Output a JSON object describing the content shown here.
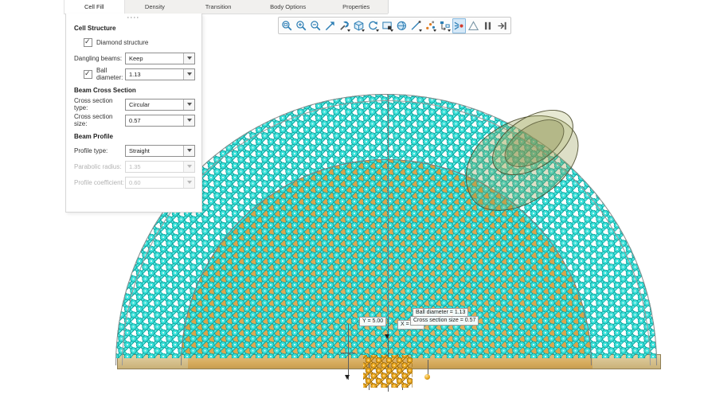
{
  "tabs": [
    {
      "label": "Cell Fill",
      "active": true
    },
    {
      "label": "Density",
      "active": false
    },
    {
      "label": "Transition",
      "active": false
    },
    {
      "label": "Body Options",
      "active": false
    },
    {
      "label": "Properties",
      "active": false
    }
  ],
  "panel": {
    "sections": [
      {
        "title": "Cell Structure",
        "fields": [
          {
            "type": "checkbox",
            "label": "Diamond structure",
            "checked": true
          },
          {
            "type": "dropdown",
            "label": "Dangling beams:",
            "value": "Keep"
          },
          {
            "type": "checkbox-dropdown",
            "label": "Ball diameter:",
            "checked": true,
            "value": "1.13"
          }
        ]
      },
      {
        "title": "Beam Cross Section",
        "fields": [
          {
            "type": "dropdown",
            "label": "Cross section type:",
            "value": "Circular"
          },
          {
            "type": "dropdown",
            "label": "Cross section size:",
            "value": "0.57"
          }
        ]
      },
      {
        "title": "Beam Profile",
        "fields": [
          {
            "type": "dropdown",
            "label": "Profile type:",
            "value": "Straight"
          },
          {
            "type": "dropdown",
            "label": "Parabolic radius:",
            "value": "1.35",
            "disabled": true
          },
          {
            "type": "dropdown",
            "label": "Profile coefficient:",
            "value": "0.60",
            "disabled": true
          }
        ]
      }
    ]
  },
  "toolbar": {
    "icons": [
      {
        "name": "zoom-window-icon"
      },
      {
        "name": "zoom-in-icon"
      },
      {
        "name": "zoom-out-icon"
      },
      {
        "name": "zoom-fit-icon"
      },
      {
        "name": "adjust-tool-icon",
        "flyout": true
      },
      {
        "name": "cube-view-icon",
        "flyout": true
      },
      {
        "name": "rotate-view-icon",
        "flyout": true
      },
      {
        "name": "snapshot-icon",
        "flyout": true
      },
      {
        "name": "shaded-view-icon"
      },
      {
        "name": "measure-icon",
        "flyout": true
      },
      {
        "name": "point-set-icon",
        "flyout": true
      },
      {
        "name": "dependencies-icon",
        "flyout": true
      },
      {
        "name": "node-preview-icon",
        "selected": true
      },
      {
        "name": "wireframe-icon"
      },
      {
        "name": "pause-icon"
      },
      {
        "name": "step-end-icon"
      }
    ]
  },
  "viewport": {
    "labels": [
      {
        "text": "Y = 5.00"
      },
      {
        "text": "X = 5.50"
      },
      {
        "text": "Ball diameter = 1.13"
      },
      {
        "text": "Cross section size = 0.57"
      }
    ],
    "colors": {
      "lattice": "#2fdcd5",
      "body_fill": "#d9a54d",
      "base_plate": "#d7c28f",
      "unit_cell": "#e8a41d"
    }
  }
}
